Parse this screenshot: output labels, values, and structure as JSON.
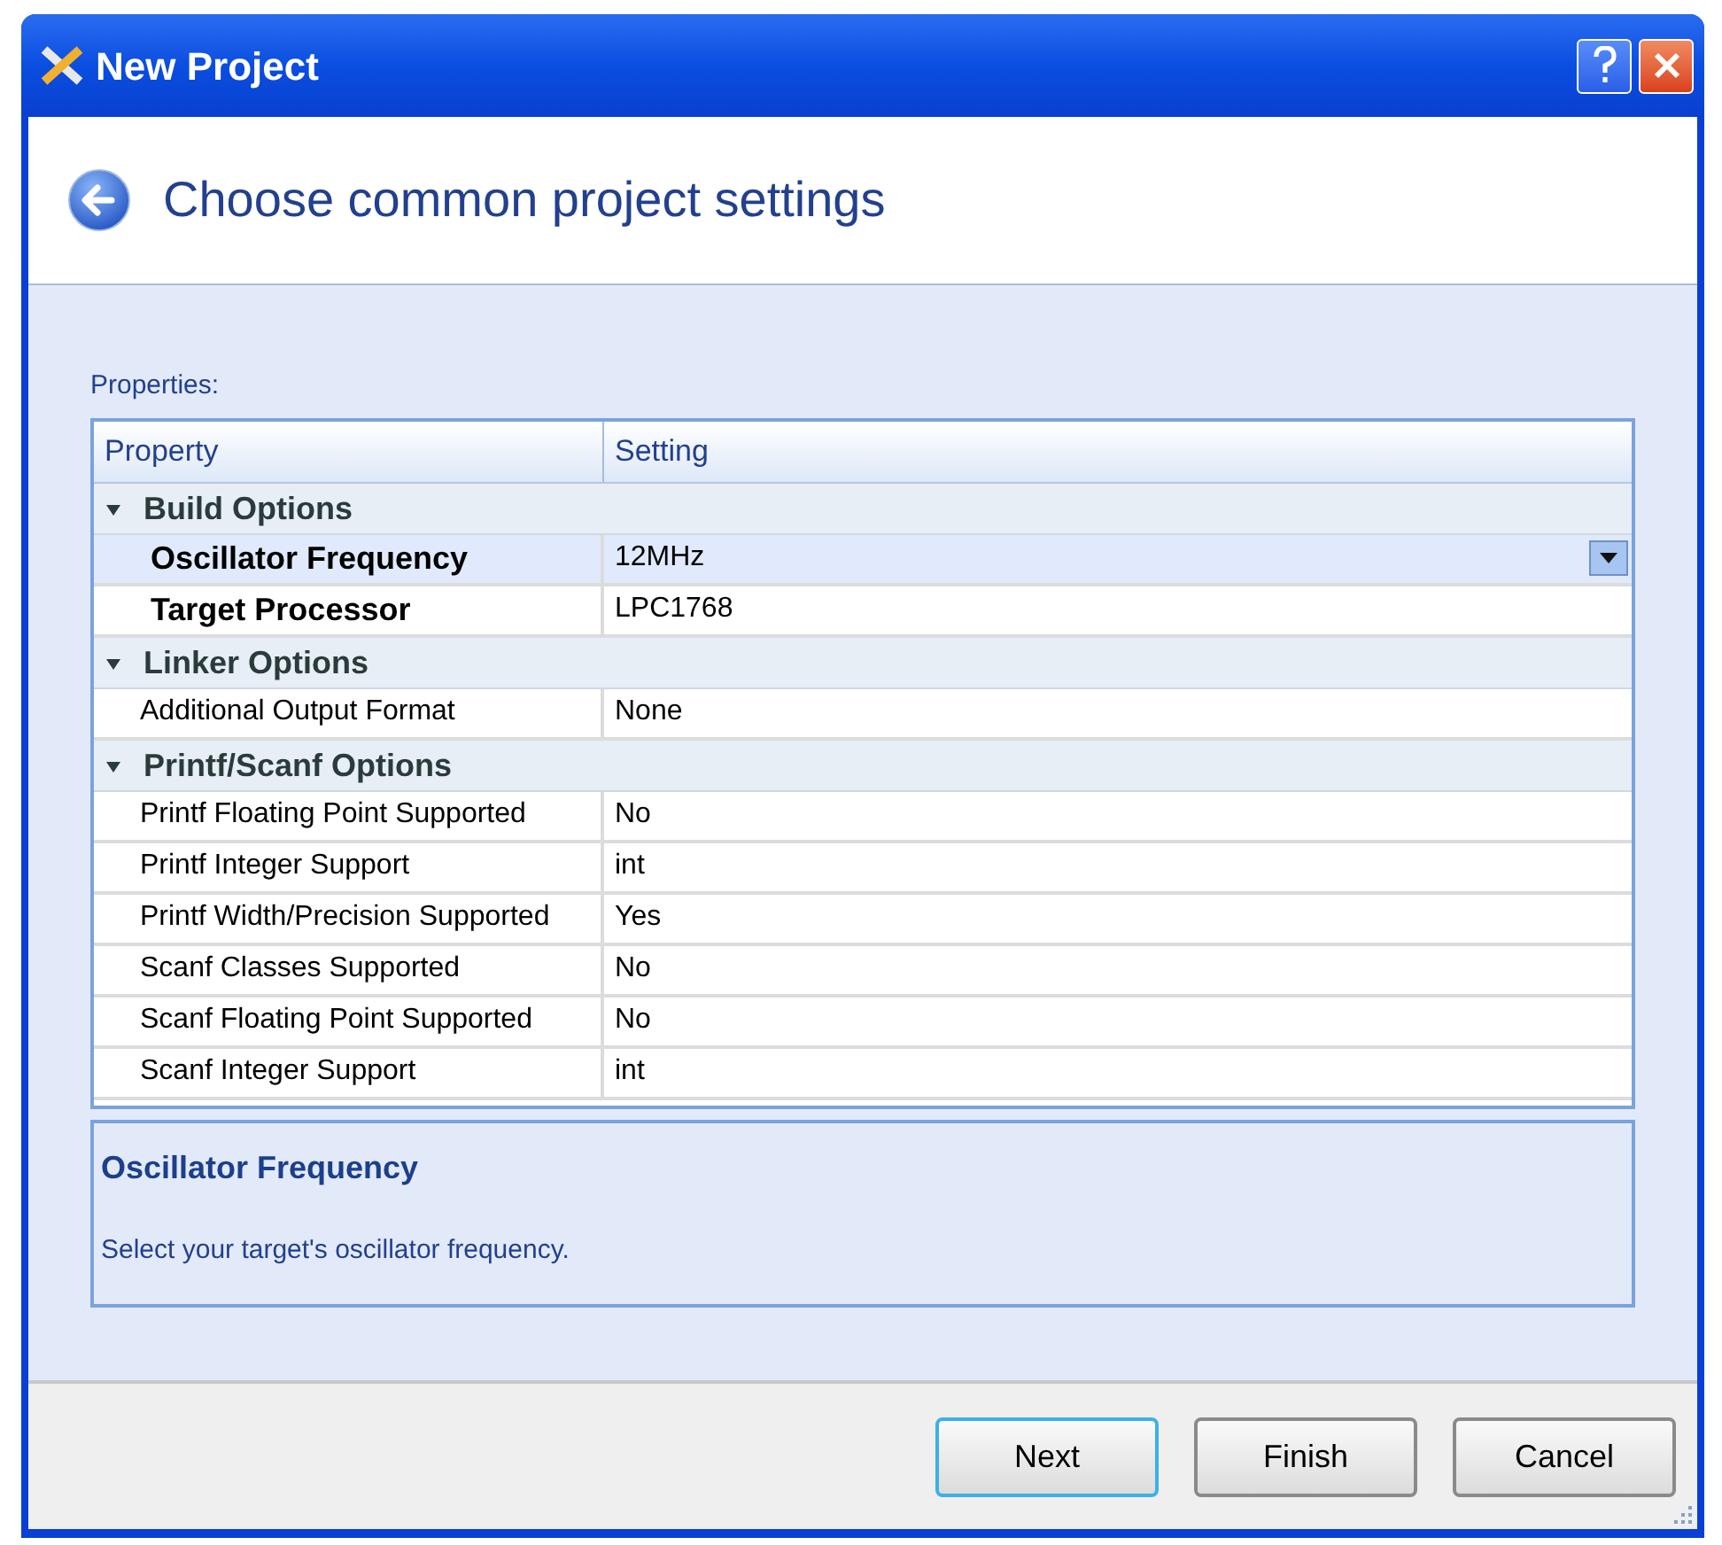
{
  "window": {
    "title": "New Project"
  },
  "header": {
    "heading": "Choose common project settings"
  },
  "properties_label": "Properties:",
  "grid": {
    "columns": [
      "Property",
      "Setting"
    ],
    "categories": [
      {
        "name": "Build Options",
        "expanded": true,
        "rows": [
          {
            "property": "Oscillator Frequency",
            "setting": "12MHz",
            "bold": true,
            "selected": true
          },
          {
            "property": "Target Processor",
            "setting": "LPC1768",
            "bold": true,
            "selected": false
          }
        ]
      },
      {
        "name": "Linker Options",
        "expanded": true,
        "rows": [
          {
            "property": "Additional Output Format",
            "setting": "None",
            "bold": false,
            "selected": false
          }
        ]
      },
      {
        "name": "Printf/Scanf Options",
        "expanded": true,
        "rows": [
          {
            "property": "Printf Floating Point Supported",
            "setting": "No",
            "bold": false,
            "selected": false
          },
          {
            "property": "Printf Integer Support",
            "setting": "int",
            "bold": false,
            "selected": false
          },
          {
            "property": "Printf Width/Precision Supported",
            "setting": "Yes",
            "bold": false,
            "selected": false
          },
          {
            "property": "Scanf Classes Supported",
            "setting": "No",
            "bold": false,
            "selected": false
          },
          {
            "property": "Scanf Floating Point Supported",
            "setting": "No",
            "bold": false,
            "selected": false
          },
          {
            "property": "Scanf Integer Support",
            "setting": "int",
            "bold": false,
            "selected": false
          }
        ]
      }
    ]
  },
  "description": {
    "title": "Oscillator Frequency",
    "text": "Select your target's oscillator frequency."
  },
  "buttons": [
    {
      "label": "Next",
      "focused": true
    },
    {
      "label": "Finish",
      "focused": false
    },
    {
      "label": "Cancel",
      "focused": false
    }
  ]
}
